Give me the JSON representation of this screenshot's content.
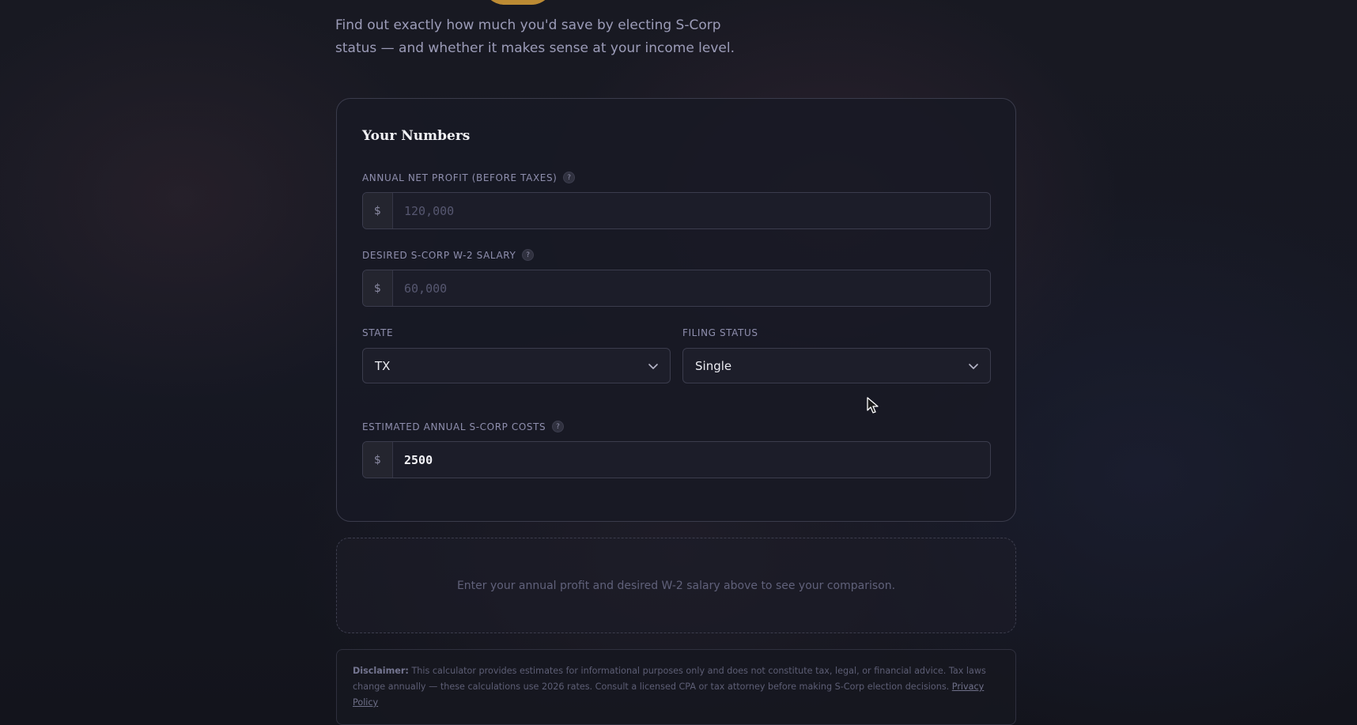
{
  "header": {
    "subtitle": "Find out exactly how much you'd save by electing S-Corp status — and whether it makes sense at your income level."
  },
  "card": {
    "title": "Your Numbers",
    "net_profit": {
      "label": "ANNUAL NET PROFIT (BEFORE TAXES)",
      "prefix": "$",
      "placeholder": "120,000",
      "value": ""
    },
    "salary": {
      "label": "DESIRED S-CORP W-2 SALARY",
      "prefix": "$",
      "placeholder": "60,000",
      "value": ""
    },
    "state": {
      "label": "STATE",
      "selected": "TX"
    },
    "filing_status": {
      "label": "FILING STATUS",
      "selected": "Single"
    },
    "costs": {
      "label": "ESTIMATED ANNUAL S-CORP COSTS",
      "prefix": "$",
      "value": "2500"
    },
    "help_glyph": "?"
  },
  "result": {
    "empty_message": "Enter your annual profit and desired W-2 salary above to see your comparison."
  },
  "disclaimer": {
    "label": "Disclaimer:",
    "text": "This calculator provides estimates for informational purposes only and does not constitute tax, legal, or financial advice. Tax laws change annually — these calculations use 2026 rates. Consult a licensed CPA or tax attorney before making S-Corp election decisions.",
    "link": "Privacy Policy"
  },
  "colors": {
    "accent": "#d9a038",
    "background": "#14161f"
  }
}
